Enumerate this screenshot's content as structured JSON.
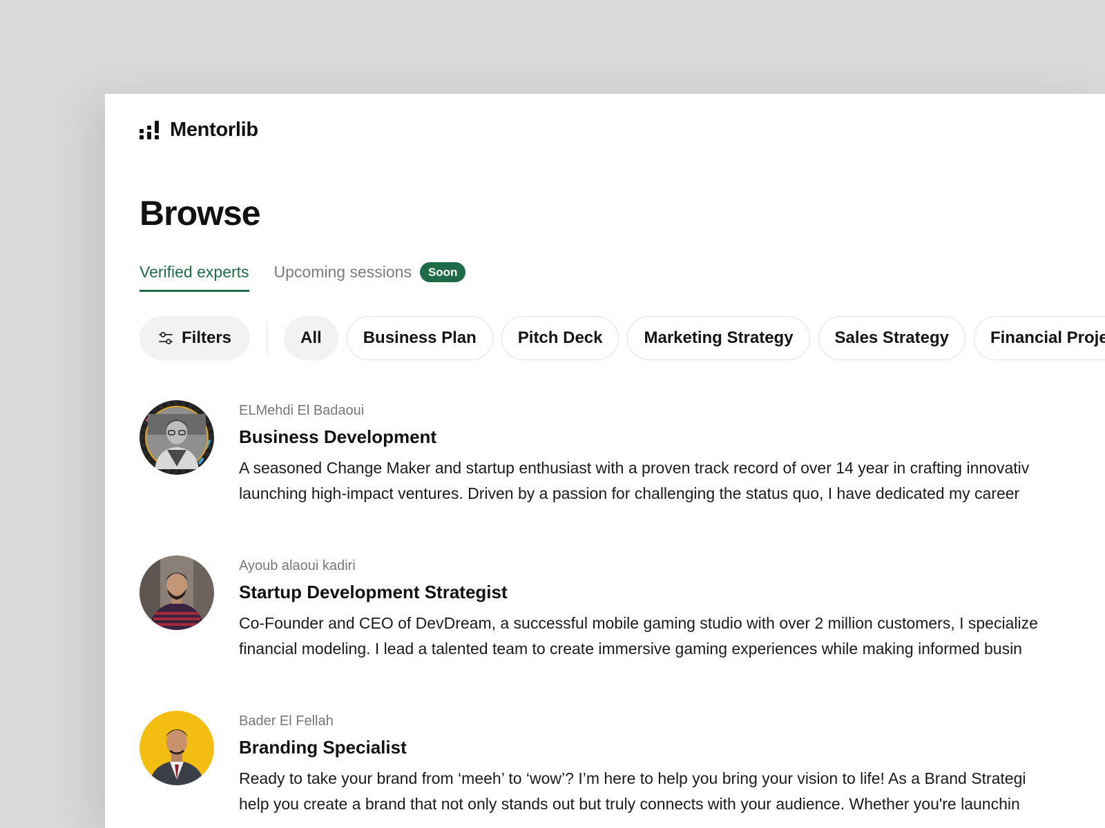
{
  "brand": {
    "name": "Mentorlib",
    "logo_icon": "bars-logo-icon"
  },
  "page": {
    "title": "Browse"
  },
  "tabs": [
    {
      "label": "Verified experts",
      "active": true
    },
    {
      "label": "Upcoming sessions",
      "active": false,
      "badge": "Soon"
    }
  ],
  "filters": {
    "label": "Filters",
    "icon": "sliders-icon",
    "categories": [
      "All",
      "Business Plan",
      "Pitch Deck",
      "Marketing Strategy",
      "Sales Strategy",
      "Financial Proje"
    ],
    "selected": "All"
  },
  "mentors": [
    {
      "name": "ELMehdi El Badaoui",
      "role": "Business Development",
      "bio_lines": [
        "A seasoned Change Maker and startup enthusiast with a proven track record of over 14 year in crafting innovativ",
        "launching high-impact ventures. Driven by a passion for challenging the status quo, I have dedicated my career"
      ]
    },
    {
      "name": "Ayoub alaoui kadiri",
      "role": "Startup Development Strategist",
      "bio_lines": [
        "Co-Founder and CEO of DevDream, a successful mobile gaming studio with over 2 million customers, I specialize",
        "financial modeling. I lead a talented team to create immersive gaming experiences while making informed busin"
      ]
    },
    {
      "name": "Bader El Fellah",
      "role": "Branding Specialist",
      "bio_lines": [
        "Ready to take your brand from ‘meeh’ to ‘wow’? I’m here to help you bring your vision to life! As a Brand Strategi",
        "help you create a brand that not only stands out but truly connects with your audience. Whether you're launchin"
      ]
    }
  ],
  "colors": {
    "accent": "#1e6b47",
    "background": "#d9d9d9",
    "avatar_yellow": "#f3bd12"
  }
}
